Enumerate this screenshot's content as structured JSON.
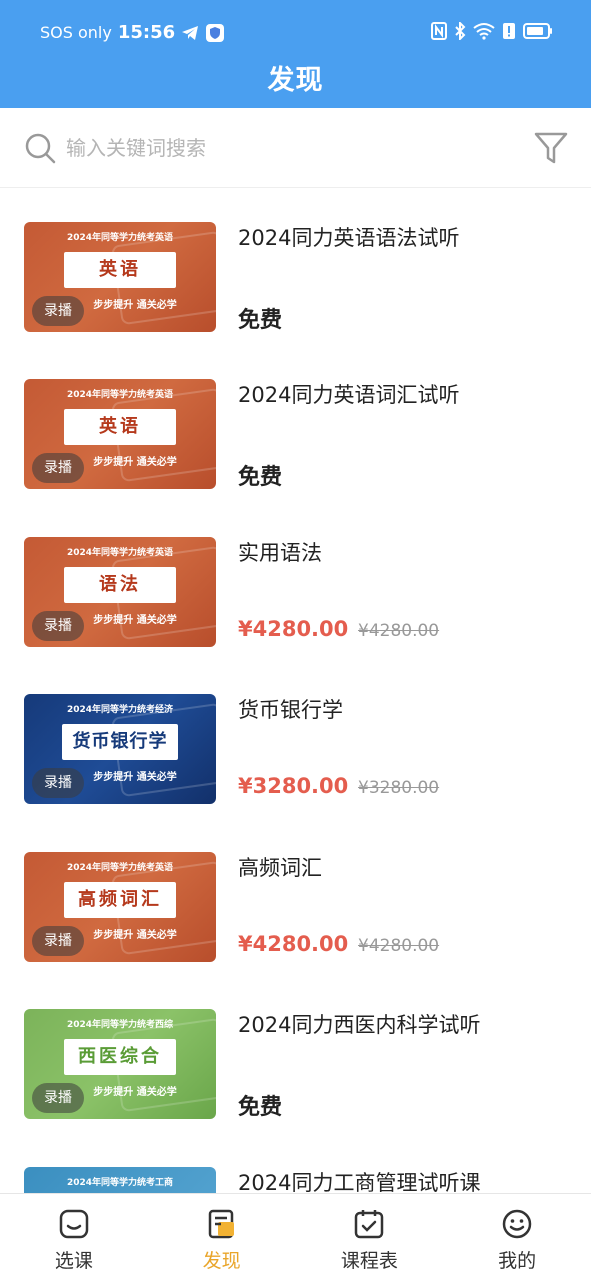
{
  "status_bar": {
    "carrier": "SOS only",
    "time": "15:56",
    "icons": [
      "telegram-icon",
      "shield-icon",
      "nfc-icon",
      "bluetooth-icon",
      "wifi-icon",
      "alert-icon",
      "battery-icon"
    ]
  },
  "header": {
    "title": "发现"
  },
  "search": {
    "placeholder": "输入关键词搜索",
    "value": ""
  },
  "courses": [
    {
      "title": "2024同力英语语法试听",
      "price_type": "free",
      "price": "免费",
      "thumb": {
        "theme": "orange",
        "top_line": "2024年同等学力统考英语",
        "subject": "英语",
        "slogan": "步步提升 通关必学",
        "badge": "录播"
      }
    },
    {
      "title": "2024同力英语词汇试听",
      "price_type": "free",
      "price": "免费",
      "thumb": {
        "theme": "orange",
        "top_line": "2024年同等学力统考英语",
        "subject": "英语",
        "slogan": "步步提升 通关必学",
        "badge": "录播"
      }
    },
    {
      "title": "实用语法",
      "price_type": "paid",
      "price": "¥4280.00",
      "original_price": "¥4280.00",
      "thumb": {
        "theme": "orange",
        "top_line": "2024年同等学力统考英语",
        "subject": "语法",
        "slogan": "步步提升 通关必学",
        "badge": "录播"
      }
    },
    {
      "title": "货币银行学",
      "price_type": "paid",
      "price": "¥3280.00",
      "original_price": "¥3280.00",
      "thumb": {
        "theme": "blue",
        "top_line": "2024年同等学力统考经济",
        "subject": "货币银行学",
        "slogan": "步步提升 通关必学",
        "badge": "录播"
      }
    },
    {
      "title": "高频词汇",
      "price_type": "paid",
      "price": "¥4280.00",
      "original_price": "¥4280.00",
      "thumb": {
        "theme": "orange",
        "top_line": "2024年同等学力统考英语",
        "subject": "高频词汇",
        "slogan": "步步提升 通关必学",
        "badge": "录播"
      }
    },
    {
      "title": "2024同力西医内科学试听",
      "price_type": "free",
      "price": "免费",
      "thumb": {
        "theme": "green",
        "top_line": "2024年同等学力统考西综",
        "subject": "西医综合",
        "slogan": "步步提升 通关必学",
        "badge": "录播"
      }
    },
    {
      "title": "2024同力工商管理试听课",
      "price_type": "free",
      "price": "",
      "thumb": {
        "theme": "teal",
        "top_line": "2024年同等学力统考工商",
        "subject": "",
        "slogan": "",
        "badge": ""
      }
    }
  ],
  "bottom_nav": [
    {
      "label": "选课",
      "icon": "course-select-icon",
      "active": false
    },
    {
      "label": "发现",
      "icon": "discover-icon",
      "active": true
    },
    {
      "label": "课程表",
      "icon": "calendar-check-icon",
      "active": false
    },
    {
      "label": "我的",
      "icon": "smiley-icon",
      "active": false
    }
  ],
  "colors": {
    "header": "#4a9ff0",
    "price": "#e45d4e",
    "nav_active": "#e9a52a"
  }
}
